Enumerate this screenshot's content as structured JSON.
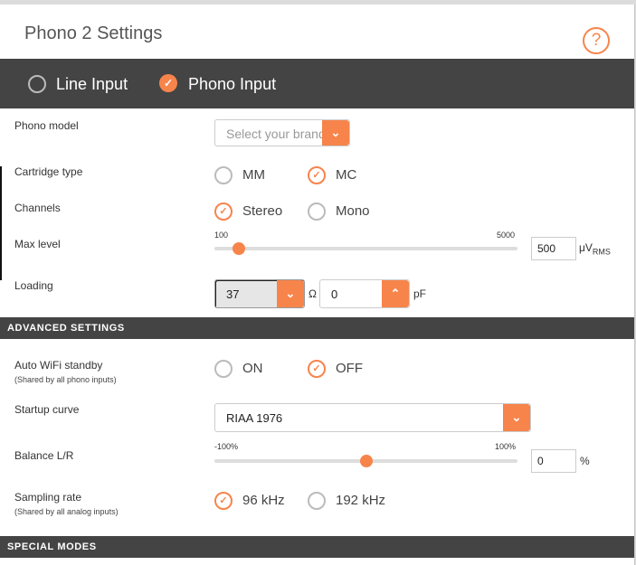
{
  "header": {
    "title": "Phono 2 Settings",
    "help_icon": "?"
  },
  "mode": {
    "line_input": "Line Input",
    "phono_input": "Phono Input",
    "selected": "phono_input"
  },
  "phono_model": {
    "label": "Phono model",
    "placeholder": "Select your brand"
  },
  "cartridge": {
    "label": "Cartridge type",
    "options": [
      "MM",
      "MC"
    ],
    "selected": "MC"
  },
  "channels": {
    "label": "Channels",
    "options": [
      "Stereo",
      "Mono"
    ],
    "selected": "Stereo"
  },
  "max_level": {
    "label": "Max level",
    "min": "100",
    "max": "5000",
    "value": "500",
    "unit_main": "μV",
    "unit_sub": "RMS",
    "fraction": 0.082
  },
  "loading": {
    "label": "Loading",
    "resistance": "37",
    "resistance_unit": "Ω",
    "capacitance": "0",
    "capacitance_unit": "pF"
  },
  "advanced": {
    "title": "ADVANCED SETTINGS"
  },
  "auto_wifi": {
    "label": "Auto WiFi standby",
    "note": "(Shared by all phono inputs)",
    "options": [
      "ON",
      "OFF"
    ],
    "selected": "OFF"
  },
  "startup_curve": {
    "label": "Startup curve",
    "value": "RIAA 1976"
  },
  "balance": {
    "label": "Balance L/R",
    "min": "-100%",
    "max": "100%",
    "value": "0",
    "unit": "%",
    "fraction": 0.5
  },
  "sampling": {
    "label": "Sampling rate",
    "note": "(Shared by all analog inputs)",
    "options": [
      "96 kHz",
      "192 kHz"
    ],
    "selected": "96 kHz"
  },
  "special": {
    "title": "SPECIAL MODES"
  },
  "colors": {
    "accent": "#f7844b",
    "bar": "#444444"
  }
}
